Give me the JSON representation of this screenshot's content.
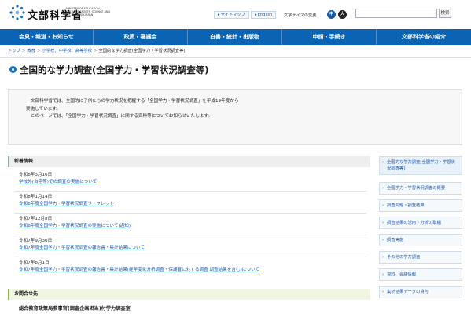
{
  "header": {
    "logo_text": "文部科学省",
    "logo_sub": "MINISTRY OF EDUCATION, CULTURE, SPORTS, SCIENCE AND TECHNOLOGY-JAPAN",
    "sitemap_label": "サイトマップ",
    "english_label": "English",
    "font_size_label": "文字サイズの変更",
    "font_small": "中",
    "font_large": "大",
    "search_placeholder": "",
    "search_button": "検索"
  },
  "nav": {
    "items": [
      "会見・報道・お知らせ",
      "政策・審議会",
      "白書・統計・出版物",
      "申請・手続き",
      "文部科学省の紹介"
    ]
  },
  "breadcrumb": {
    "items": [
      "トップ",
      "教育",
      "小学校、中学校、高等学校"
    ],
    "current": "全国的な学力調査(全国学力・学習状況調査等)"
  },
  "page": {
    "title": "全国的な学力調査(全国学力・学習状況調査等)",
    "intro_line1": "文部科学省では、全国的に子供たちの学力状況を把握する「全国学力・学習状況調査」を平成19年度から",
    "intro_line2": "実施しています。",
    "intro_line3": "このページでは、「全国学力・学習状況調査」に関する資料等についてお知らせいたします。"
  },
  "news": {
    "heading": "新着情報",
    "items": [
      {
        "date": "令和8年3月16日",
        "title": "学校外(自宅等)での調査の実施について"
      },
      {
        "date": "令和8年1月14日",
        "title": "令和8年度全国学力・学習状況調査リーフレット"
      },
      {
        "date": "令和7年12月8日",
        "title": "令和8年度全国学力・学習状況調査の実施について(通知)"
      },
      {
        "date": "令和7年9月30日",
        "title": "令和7年度全国学力・学習状況調査の報告書・集計結果について"
      },
      {
        "date": "令和7年8月1日",
        "title": "令和7年度全国学力・学習状況調査の報告書・集計結果(経年変化分析調査・保護者に対する調査 調査結果を含む)について"
      }
    ]
  },
  "contact": {
    "heading": "お問合せ先",
    "body": "総合教育政策局参事官(調査企画担当)付学力調査室"
  },
  "sidebar": {
    "items": [
      "全国的な学力調査(全国学力・学習状況調査等)",
      "全国学力・学習状況調査の概要",
      "調査問題・調査結果",
      "調査結果の活用・分析の取組",
      "調査実施",
      "その他の学力調査",
      "資料、会議情報",
      "集計結果データの貸与"
    ]
  },
  "colors": {
    "nav_blue": "#0a63b3",
    "font_small_btn": "#1e5aa0",
    "font_large_btn": "#222222"
  }
}
